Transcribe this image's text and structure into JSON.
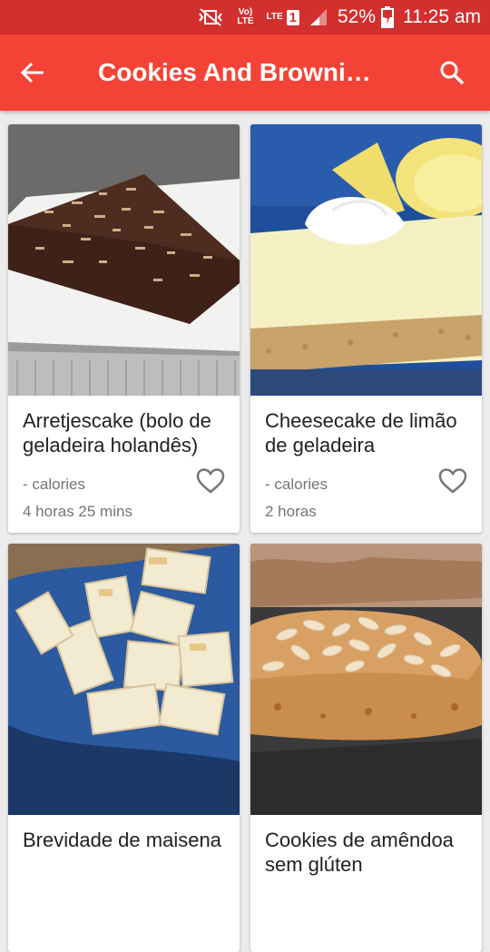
{
  "status": {
    "battery": "52%",
    "time": "11:25 am",
    "volte": "Vo) LTE",
    "lte": "LTE",
    "sim": "1"
  },
  "header": {
    "title": "Cookies And Brownies…"
  },
  "recipes": [
    {
      "name": "Arretjescake (bolo de geladeira holandês)",
      "calories": "- calories",
      "time": "4 horas 25 mins"
    },
    {
      "name": "Cheesecake de limão de geladeira",
      "calories": "- calories",
      "time": "2 horas"
    },
    {
      "name": "Brevidade de maisena",
      "calories": "",
      "time": ""
    },
    {
      "name": "Cookies de amêndoa sem glúten",
      "calories": "",
      "time": ""
    }
  ],
  "colors": {
    "status_bar": "#d32f2f",
    "app_bar": "#f44336",
    "background": "#ececec"
  },
  "icons": [
    "back-arrow-icon",
    "search-icon",
    "heart-outline-icon"
  ]
}
